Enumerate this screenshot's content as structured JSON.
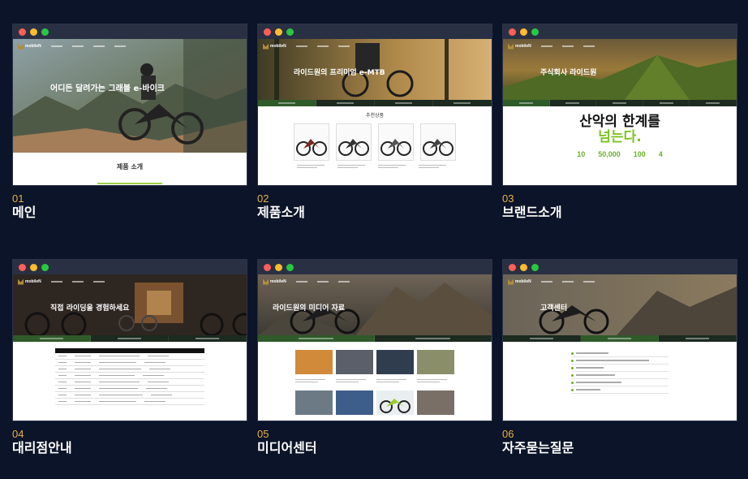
{
  "brand": {
    "logo_text": "mobileN"
  },
  "cards": [
    {
      "num": "01",
      "label": "메인",
      "hero_text": "어디든 달려가는 그래블 e-바이크",
      "section_title": "제품 소개"
    },
    {
      "num": "02",
      "label": "제품소개",
      "hero_text": "라이드원의 프리미엄 e-MTB",
      "section_title": "추천상품"
    },
    {
      "num": "03",
      "label": "브랜드소개",
      "hero_text": "주식회사 라이드원",
      "headline_1": "산악의 한계를",
      "headline_2": "넘는다.",
      "stats": [
        "10",
        "50,000",
        "100",
        "4"
      ]
    },
    {
      "num": "04",
      "label": "대리점안내",
      "hero_text": "직접 라이딩을 경험하세요"
    },
    {
      "num": "05",
      "label": "미디어센터",
      "hero_text": "라이드원의 미디어 자료"
    },
    {
      "num": "06",
      "label": "자주묻는질문",
      "hero_text": "고객센터"
    }
  ]
}
